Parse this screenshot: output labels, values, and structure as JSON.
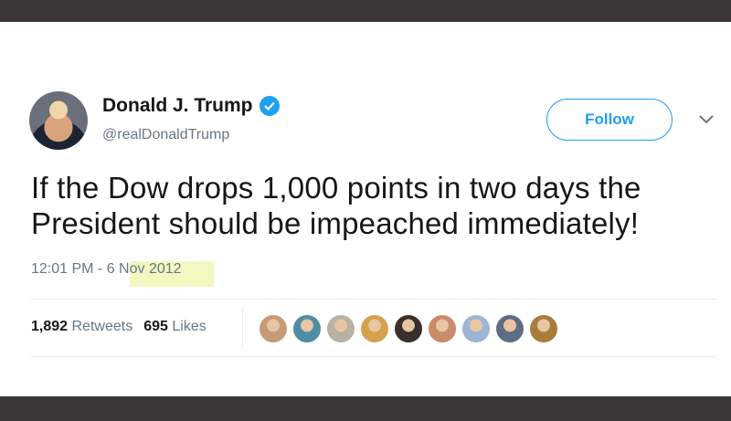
{
  "profile": {
    "display_name": "Donald J. Trump",
    "handle": "@realDonaldTrump",
    "verified": true
  },
  "follow_button": {
    "label": "Follow"
  },
  "tweet": {
    "text": "If the Dow drops 1,000 points in two days the President should be impeached immediately!",
    "timestamp": "12:01 PM - 6 Nov 2012"
  },
  "stats": {
    "retweets_count": "1,892",
    "retweets_label": "Retweets",
    "likes_count": "695",
    "likes_label": "Likes"
  },
  "likers": [
    {
      "color": "#c59a77"
    },
    {
      "color": "#4f8ea2"
    },
    {
      "color": "#b8b1a4"
    },
    {
      "color": "#d4a24f"
    },
    {
      "color": "#3b2f2b"
    },
    {
      "color": "#c98b6a"
    },
    {
      "color": "#9db5d4"
    },
    {
      "color": "#5f6d84"
    },
    {
      "color": "#a77d3e"
    }
  ],
  "colors": {
    "accent": "#1da1f2",
    "text": "#14171a",
    "secondary": "#657786",
    "highlight": "#e9f08c"
  }
}
